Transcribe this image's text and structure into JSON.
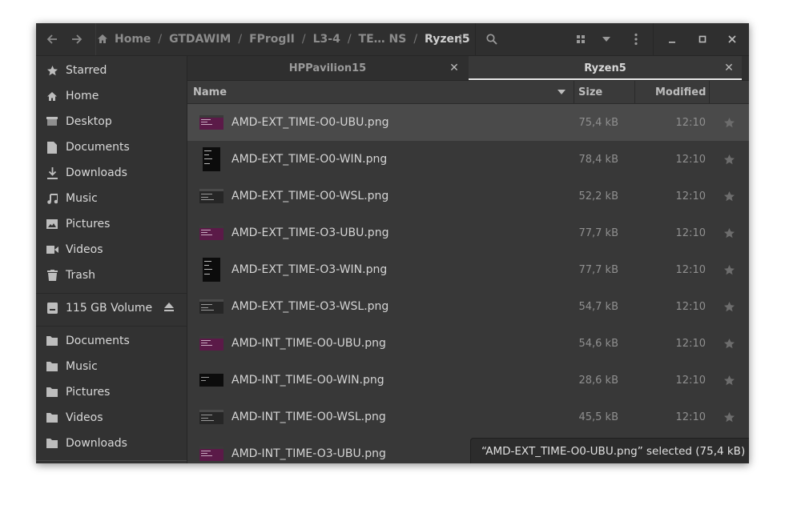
{
  "header": {
    "breadcrumbs": [
      "Home",
      "GTDAWIM",
      "FProgII",
      "L3-4",
      "TE… NS",
      "Ryzen5"
    ],
    "separator": "/",
    "icons": [
      "back-arrow-icon",
      "forward-arrow-icon",
      "home-icon",
      "path-menu-icon",
      "search-icon",
      "view-grid-icon",
      "chevron-down-icon",
      "main-menu-icon",
      "minimize-icon",
      "maximize-icon",
      "close-icon"
    ]
  },
  "sidebar": {
    "places": [
      {
        "label": "Starred",
        "icon": "star-icon"
      },
      {
        "label": "Home",
        "icon": "home-icon"
      },
      {
        "label": "Desktop",
        "icon": "desktop-icon"
      },
      {
        "label": "Documents",
        "icon": "document-icon"
      },
      {
        "label": "Downloads",
        "icon": "download-icon"
      },
      {
        "label": "Music",
        "icon": "music-icon"
      },
      {
        "label": "Pictures",
        "icon": "picture-icon"
      },
      {
        "label": "Videos",
        "icon": "video-icon"
      },
      {
        "label": "Trash",
        "icon": "trash-icon"
      }
    ],
    "volume": {
      "label": "115 GB Volume",
      "icon": "drive-icon",
      "eject_icon": "eject-icon"
    },
    "bookmarks": [
      {
        "label": "Documents",
        "icon": "folder-icon"
      },
      {
        "label": "Music",
        "icon": "folder-icon"
      },
      {
        "label": "Pictures",
        "icon": "folder-icon"
      },
      {
        "label": "Videos",
        "icon": "folder-icon"
      },
      {
        "label": "Downloads",
        "icon": "folder-icon"
      }
    ]
  },
  "tabs": [
    {
      "label": "HPPavilion15",
      "active": false
    },
    {
      "label": "Ryzen5",
      "active": true
    }
  ],
  "columns": {
    "name": "Name",
    "size": "Size",
    "modified": "Modified"
  },
  "files": [
    {
      "name": "AMD-EXT_TIME-O0-UBU.png",
      "size": "75,4 kB",
      "modified": "12:10",
      "thumb": "ubuntu",
      "selected": true
    },
    {
      "name": "AMD-EXT_TIME-O0-WIN.png",
      "size": "78,4 kB",
      "modified": "12:10",
      "thumb": "win",
      "selected": false
    },
    {
      "name": "AMD-EXT_TIME-O0-WSL.png",
      "size": "52,2 kB",
      "modified": "12:10",
      "thumb": "wsl",
      "selected": false
    },
    {
      "name": "AMD-EXT_TIME-O3-UBU.png",
      "size": "77,7 kB",
      "modified": "12:10",
      "thumb": "ubuntu",
      "selected": false
    },
    {
      "name": "AMD-EXT_TIME-O3-WIN.png",
      "size": "77,7 kB",
      "modified": "12:10",
      "thumb": "win",
      "selected": false
    },
    {
      "name": "AMD-EXT_TIME-O3-WSL.png",
      "size": "54,7 kB",
      "modified": "12:10",
      "thumb": "wsl",
      "selected": false
    },
    {
      "name": "AMD-INT_TIME-O0-UBU.png",
      "size": "54,6 kB",
      "modified": "12:10",
      "thumb": "ubuntu",
      "selected": false
    },
    {
      "name": "AMD-INT_TIME-O0-WIN.png",
      "size": "28,6 kB",
      "modified": "12:10",
      "thumb": "win-wide",
      "selected": false
    },
    {
      "name": "AMD-INT_TIME-O0-WSL.png",
      "size": "45,5 kB",
      "modified": "12:10",
      "thumb": "wsl",
      "selected": false
    },
    {
      "name": "AMD-INT_TIME-O3-UBU.png",
      "size": "",
      "modified": "",
      "thumb": "ubuntu",
      "selected": false
    }
  ],
  "status": {
    "text": "“AMD-EXT_TIME-O0-UBU.png” selected  (75,4 kB)"
  },
  "colors": {
    "window_bg": "#383838",
    "sidebar_bg": "#323232",
    "header_bg": "#2f2f2f",
    "selected_row": "#4a4a4a",
    "ubuntu_thumb": "#5c1a4a"
  }
}
